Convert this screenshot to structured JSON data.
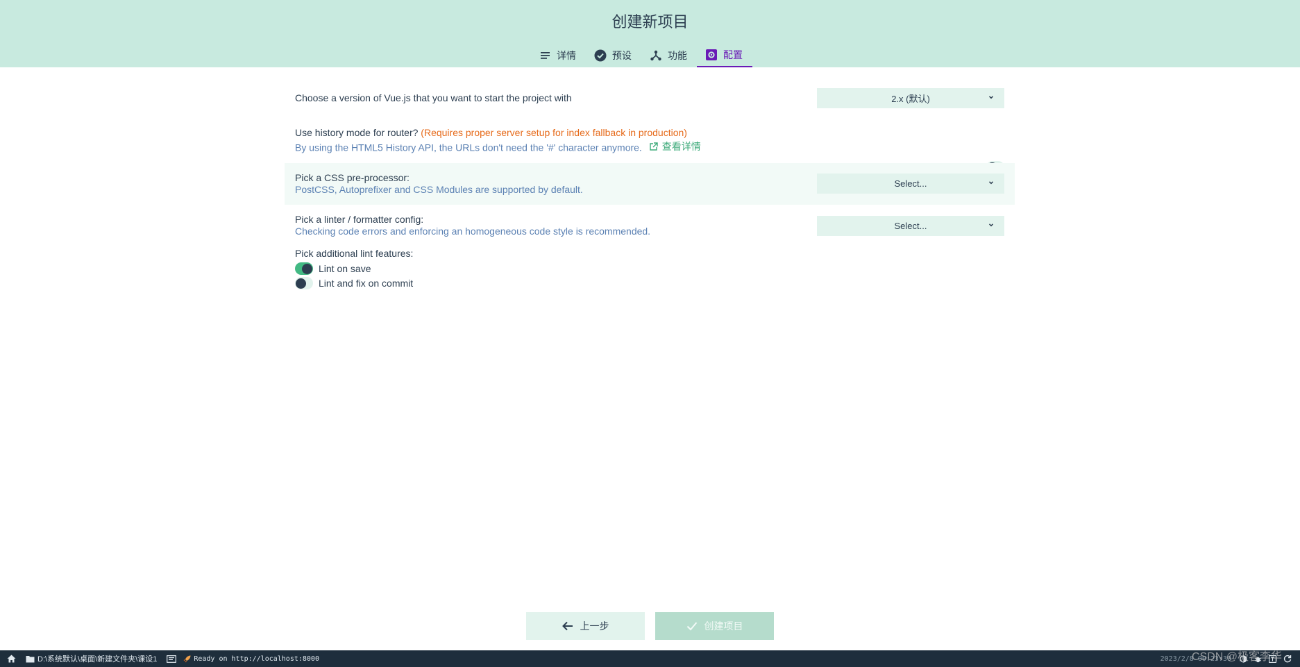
{
  "header": {
    "title": "创建新项目",
    "tabs": [
      {
        "label": "详情",
        "icon": "list-icon",
        "active": false
      },
      {
        "label": "预设",
        "icon": "check-circle-icon",
        "active": false
      },
      {
        "label": "功能",
        "icon": "fork-icon",
        "active": false
      },
      {
        "label": "配置",
        "icon": "settings-icon",
        "active": true
      }
    ],
    "accent": "#6a1bb6",
    "background": "#c8eadf"
  },
  "config": {
    "vue_version": {
      "label": "Choose a version of Vue.js that you want to start the project with",
      "value": "2.x (默认)"
    },
    "history_mode": {
      "label": "Use history mode for router?",
      "warning": "(Requires proper server setup for index fallback in production)",
      "description": "By using the HTML5 History API, the URLs don't need the '#' character anymore.",
      "more_link": "查看详情",
      "enabled": false
    },
    "css_preprocessor": {
      "label": "Pick a CSS pre-processor:",
      "description": "PostCSS, Autoprefixer and CSS Modules are supported by default.",
      "value": "Select..."
    },
    "linter": {
      "label": "Pick a linter / formatter config:",
      "description": "Checking code errors and enforcing an homogeneous code style is recommended.",
      "value": "Select..."
    },
    "lint_features": {
      "label": "Pick additional lint features:",
      "options": [
        {
          "label": "Lint on save",
          "enabled": true
        },
        {
          "label": "Lint and fix on commit",
          "enabled": false
        }
      ]
    }
  },
  "footer": {
    "prev_label": "上一步",
    "create_label": "创建项目"
  },
  "statusbar": {
    "path": "D:\\系统默认\\桌面\\新建文件夹\\课设1",
    "log": "Ready on http://localhost:8000",
    "time": "2023/2/8 00:23:30"
  },
  "watermark": "CSDN @极客李华"
}
